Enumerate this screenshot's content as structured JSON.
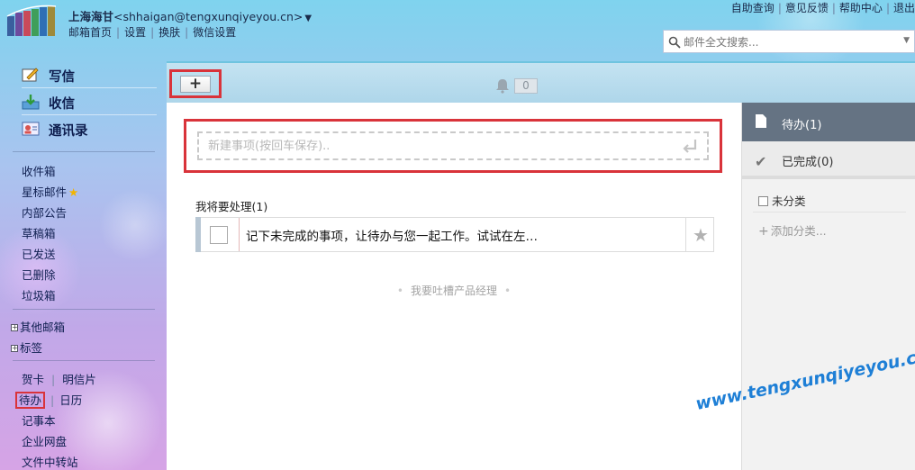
{
  "header": {
    "user_name": "上海海甘",
    "user_email": "<shhaigan@tengxunqiyeyou.cn>",
    "links": [
      "邮箱首页",
      "设置",
      "换肤",
      "微信设置"
    ],
    "top_links": [
      "自助查询",
      "意见反馈",
      "帮助中心",
      "退出"
    ]
  },
  "search": {
    "placeholder": "邮件全文搜索..."
  },
  "sidebar": {
    "compose": "写信",
    "receive": "收信",
    "contacts": "通讯录",
    "folders": [
      "收件箱",
      "星标邮件",
      "内部公告",
      "草稿箱",
      "已发送",
      "已删除",
      "垃圾箱"
    ],
    "other_mailbox": "其他邮箱",
    "tags": "标签",
    "apps_row1": [
      "贺卡",
      "明信片"
    ],
    "apps_row2": [
      "待办",
      "日历"
    ],
    "apps": [
      "记事本",
      "企业网盘",
      "文件中转站"
    ]
  },
  "toolbar": {
    "add_label": "+",
    "reminder_count": "0"
  },
  "new_item": {
    "placeholder": "新建事项(按回车保存).."
  },
  "section": {
    "title": "我将要处理(1)"
  },
  "tasks": [
    {
      "text": "记下未完成的事项，让待办与您一起工作。试试在左…"
    }
  ],
  "feedback": {
    "text": "我要吐槽产品经理"
  },
  "right_panel": {
    "todo_tab": "待办(1)",
    "done_tab": "已完成(0)",
    "uncategorized": "未分类",
    "add_category": "添加分类..."
  },
  "watermark": "www.tengxunqiyeyou.com",
  "colors": {
    "highlight_border": "#d9333a",
    "active_tab_bg": "#657383",
    "toolbar_bg": "#aed6ea"
  }
}
